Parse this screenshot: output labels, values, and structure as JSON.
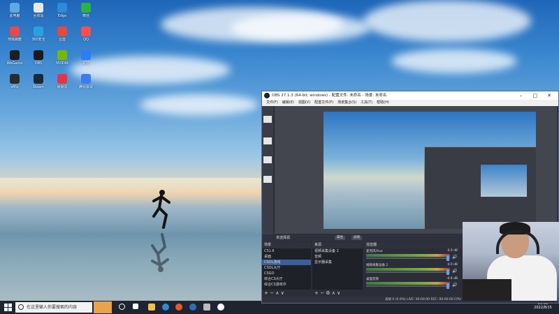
{
  "desktop": {
    "icons": [
      {
        "label": "此电脑",
        "color": "#5fa8e0"
      },
      {
        "label": "地铁跑酷",
        "color": "#e94848"
      },
      {
        "label": "WeGame",
        "color": "#1e1e1e"
      },
      {
        "label": "vMix",
        "color": "#2b2b2b"
      },
      {
        "label": "回收站",
        "color": "#e8e8e8"
      },
      {
        "label": "360安全",
        "color": "#27a2e0"
      },
      {
        "label": "OBS",
        "color": "#1a1a1a"
      },
      {
        "label": "Steam",
        "color": "#1b2838"
      },
      {
        "label": "Edge",
        "color": "#2f8ad8"
      },
      {
        "label": "迅雷",
        "color": "#e34b3c"
      },
      {
        "label": "NVIDIA",
        "color": "#76b900"
      },
      {
        "label": "网易云",
        "color": "#e2354a"
      },
      {
        "label": "微信",
        "color": "#2ab540"
      },
      {
        "label": "QQ",
        "color": "#ff4d4d"
      },
      {
        "label": "钉钉",
        "color": "#2e7df6"
      },
      {
        "label": "腾讯会议",
        "color": "#3b7bf0"
      }
    ]
  },
  "taskbar": {
    "search_placeholder": "在这里输入你要搜索的内容",
    "time": "20:11",
    "date": "2022/8/15"
  },
  "obs": {
    "title": "OBS 27.1.3 (64-bit, windows) - 配置文件: 未命名 - 场景: 未命名",
    "menu": [
      "文件(F)",
      "编辑(E)",
      "视图(V)",
      "配置文件(P)",
      "场景集合(S)",
      "工具(T)",
      "帮助(H)"
    ],
    "no_source_label": "未选择源",
    "properties_button": "属性",
    "filters_button": "滤镜",
    "scenes_header": "场景",
    "scenes": [
      "CS1.6",
      "桌面",
      "CSOL游戏",
      "CSOL大厅",
      "CSGO",
      "综合CS大厅",
      "综合CS游戏中"
    ],
    "sources_header": "来源",
    "sources": [
      "视频采集设备 2",
      "音频",
      "显示器采集"
    ],
    "mixer_header": "混音器",
    "mixer": [
      {
        "name": "麦克风/Aux",
        "db": "0.0 dB"
      },
      {
        "name": "视频采集设备 2",
        "db": "0.0 dB"
      },
      {
        "name": "桌面音频",
        "db": "-0.6 dB"
      }
    ],
    "status_text": "丢帧 0 (0.0%)  LIVE: 00:00:00  REC: 00:00:00  CPU: 7.0%, 60.00 fps  kb/s: 6957"
  }
}
